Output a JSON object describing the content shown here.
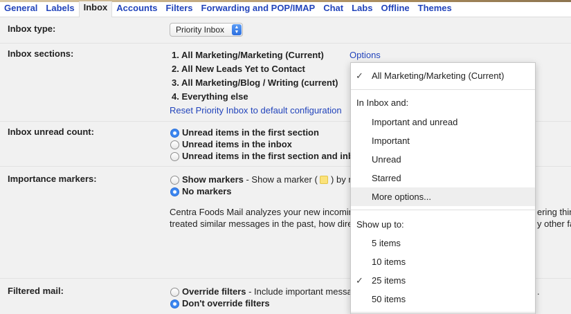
{
  "tabs": [
    "General",
    "Labels",
    "Inbox",
    "Accounts",
    "Filters",
    "Forwarding and POP/IMAP",
    "Chat",
    "Labs",
    "Offline",
    "Themes"
  ],
  "active_tab": "Inbox",
  "inbox_type": {
    "label": "Inbox type:",
    "selected": "Priority Inbox"
  },
  "inbox_sections": {
    "label": "Inbox sections:",
    "items": [
      "1. All Marketing/Marketing (Current)",
      "2. All New Leads Yet to Contact",
      "3. All Marketing/Blog / Writing (current)",
      "4. Everything else"
    ],
    "options_link": "Options",
    "reset_link": "Reset Priority Inbox to default configuration"
  },
  "unread_count": {
    "label": "Inbox unread count:",
    "options": [
      "Unread items in the first section",
      "Unread items in the inbox",
      "Unread items in the first section and inb"
    ],
    "selected_index": 0
  },
  "importance": {
    "label": "Importance markers:",
    "show_label": "Show markers",
    "show_desc": " - Show a marker (",
    "show_desc_tail": ") by m",
    "no_label": "No markers",
    "selected_index": 1,
    "paragraph_line1": "Centra Foods Mail analyzes your new incomin",
    "paragraph_line1_right": "ering thin",
    "paragraph_line2": "treated similar messages in the past, how dire",
    "paragraph_line2_right": "y other fa"
  },
  "filtered": {
    "label": "Filtered mail:",
    "override_label": "Override filters",
    "override_desc": " - Include important messa",
    "override_tail": ".",
    "dont_label": "Don't override filters",
    "selected_index": 1
  },
  "menu": {
    "current": "All Marketing/Marketing (Current)",
    "inbox_and_header": "In Inbox and:",
    "inbox_and": [
      "Important and unread",
      "Important",
      "Unread",
      "Starred",
      "More options..."
    ],
    "show_up_to_header": "Show up to:",
    "counts": [
      "5 items",
      "10 items",
      "25 items",
      "50 items"
    ],
    "selected_count_index": 2,
    "check_glyph": "✓"
  }
}
